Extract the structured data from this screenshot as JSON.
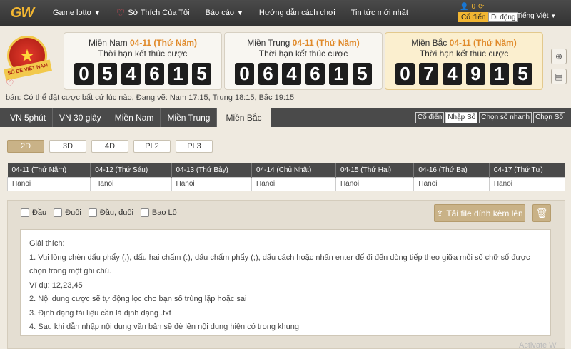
{
  "nav": {
    "logo": "GW",
    "items": [
      {
        "label": "Game lotto",
        "dropdown": true
      },
      {
        "label": "Sở Thích Của Tôi",
        "icon": "heart-icon"
      },
      {
        "label": "Báo cáo",
        "dropdown": true
      },
      {
        "label": "Hướng dẫn cách chơi"
      },
      {
        "label": "Tin tức mới nhất"
      }
    ],
    "balance": "0",
    "mode_classic": "Cổ điển",
    "mode_mobile": "Di động",
    "language": "Tiếng Việt"
  },
  "emblem": {
    "text": "SỔ ĐỀ VIỆT NAM"
  },
  "regions": [
    {
      "name": "Miền Nam",
      "date": "04-11 (Thứ Năm)",
      "subtitle": "Thời hạn kết thúc cược",
      "digits": [
        "0",
        "5",
        "4",
        "6",
        "1",
        "5"
      ]
    },
    {
      "name": "Miền Trung",
      "date": "04-11 (Thứ Năm)",
      "subtitle": "Thời hạn kết thúc cược",
      "digits": [
        "0",
        "6",
        "4",
        "6",
        "1",
        "5"
      ]
    },
    {
      "name": "Miền Bắc",
      "date": "04-11 (Thứ Năm)",
      "subtitle": "Thời hạn kết thúc cược",
      "digits": [
        "0",
        "7",
        "4",
        "9",
        "1",
        "5"
      ]
    }
  ],
  "notice": "bán: Có thể đặt cược bất cứ lúc nào,   Đang vẽ: Nam 17:15, Trung 18:15, Bắc 19:15",
  "tabs": [
    "VN 5phút",
    "VN 30 giây",
    "Miền Nam",
    "Miền Trung",
    "Miền Bắc"
  ],
  "active_tab": "Miền Bắc",
  "input_modes": [
    "Cổ điển",
    "Nhập Số",
    "Chọn số nhanh",
    "Chọn Số"
  ],
  "active_input_mode": "Nhập Số",
  "game_types": [
    "2D",
    "3D",
    "4D",
    "PL2",
    "PL3"
  ],
  "active_game_type": "2D",
  "draw_dates": [
    {
      "date": "04-11 (Thứ Năm)",
      "city": "Hanoi"
    },
    {
      "date": "04-12 (Thứ Sáu)",
      "city": "Hanoi"
    },
    {
      "date": "04-13 (Thứ Bảy)",
      "city": "Hanoi"
    },
    {
      "date": "04-14 (Chủ Nhật)",
      "city": "Hanoi"
    },
    {
      "date": "04-15 (Thứ Hai)",
      "city": "Hanoi"
    },
    {
      "date": "04-16 (Thứ Ba)",
      "city": "Hanoi"
    },
    {
      "date": "04-17 (Thứ Tư)",
      "city": "Hanoi"
    }
  ],
  "bet_options": [
    "Đầu",
    "Đuôi",
    "Đầu, đuôi",
    "Bao Lô"
  ],
  "upload_label": "Tải file đính kèm lên",
  "help": {
    "title": "Giải thích:",
    "lines": [
      "1. Vui lòng chèn dấu phẩy (,), dấu hai chấm (:), dấu chấm phẩy (;), dấu cách hoặc nhấn enter để đi đến dòng tiếp theo giữa mỗi số chữ số được chọn trong một ghi chú.",
      "Ví dụ: 12,23,45",
      "2. Nội dung cược sẽ tự động lọc cho bạn số trùng lặp hoặc sai",
      "3. Định dạng tài liệu cần là định dạng .txt",
      "4. Sau khi dẫn nhập nội dung văn bản sẽ đè lên nội dung hiện có trong khung"
    ]
  },
  "watermark": "Activate W"
}
